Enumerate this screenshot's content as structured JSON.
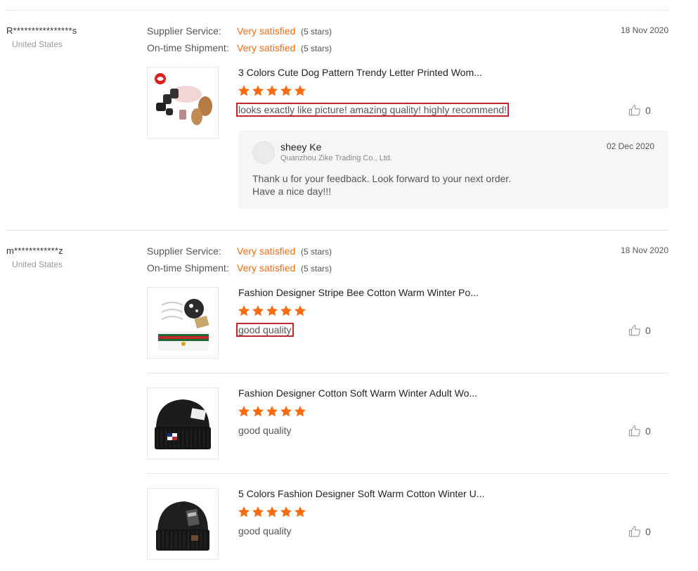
{
  "reviews": [
    {
      "reviewer": "R****************s",
      "country": "United States",
      "date": "18 Nov 2020",
      "supplier_service": {
        "label": "Supplier Service:",
        "value": "Very satisfied",
        "stars": "(5 stars)"
      },
      "shipment": {
        "label": "On-time Shipment:",
        "value": "Very satisfied",
        "stars": "(5 stars)"
      },
      "items": [
        {
          "title": "3 Colors Cute Dog Pattern Trendy Letter Printed Wom...",
          "rating": 5,
          "text": "looks exactly like picture! amazing quality! highly recommend!",
          "likes": "0"
        }
      ],
      "reply": {
        "name": "sheey Ke",
        "company": "Quanzhou Zike Trading Co., Ltd.",
        "date": "02 Dec 2020",
        "line1": "Thank u for your feedback. Look forward to your next order.",
        "line2": "Have a nice day!!!"
      }
    },
    {
      "reviewer": "m************z",
      "country": "United States",
      "date": "18 Nov 2020",
      "supplier_service": {
        "label": "Supplier Service:",
        "value": "Very satisfied",
        "stars": "(5 stars)"
      },
      "shipment": {
        "label": "On-time Shipment:",
        "value": "Very satisfied",
        "stars": "(5 stars)"
      },
      "items": [
        {
          "title": "Fashion Designer Stripe Bee Cotton Warm Winter Po...",
          "rating": 5,
          "text": "good quality",
          "likes": "0"
        },
        {
          "title": "Fashion Designer Cotton Soft Warm Winter Adult Wo...",
          "rating": 5,
          "text": "good quality",
          "likes": "0"
        },
        {
          "title": "5 Colors Fashion Designer Soft Warm Cotton Winter U...",
          "rating": 5,
          "text": "good quality",
          "likes": "0"
        }
      ]
    }
  ],
  "colors": {
    "accent": "#f96b10",
    "highlight": "#c0282e",
    "star": "#f96b10"
  },
  "icons": {
    "star": "star-icon",
    "like": "thumbs-up-icon",
    "avatar": "avatar-icon"
  }
}
